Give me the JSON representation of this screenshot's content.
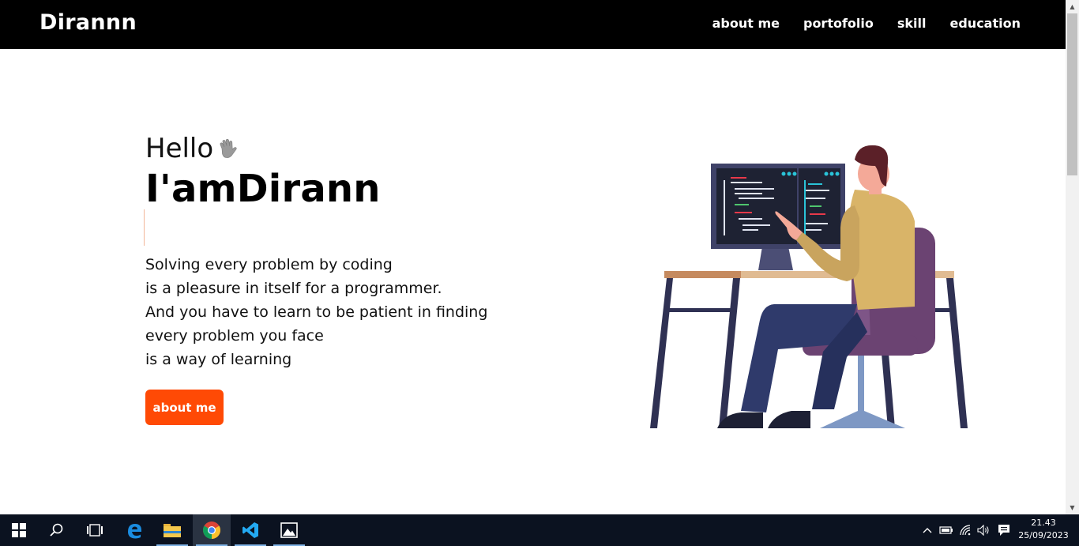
{
  "navbar": {
    "brand": "Dirannn",
    "links": [
      "about me",
      "portofolio",
      "skill",
      "education"
    ]
  },
  "hero": {
    "greeting": "Hello",
    "greeting_icon": "waving-hand-icon",
    "name": "I'amDirann",
    "description": [
      "Solving every problem by coding",
      "is a pleasure in itself for a programmer.",
      "And you have to learn to be patient in finding",
      "every problem you face",
      "is a way of learning"
    ],
    "cta_label": "about me"
  },
  "illustration": "programmer-at-desk-illustration",
  "colors": {
    "navbar_bg": "#000000",
    "accent": "#ff4a05",
    "text": "#111111"
  },
  "taskbar": {
    "apps": [
      "start-icon",
      "search-icon",
      "task-view-icon",
      "edge-icon",
      "file-explorer-icon",
      "chrome-icon",
      "vscode-icon",
      "photos-icon"
    ],
    "time": "21.43",
    "date": "25/09/2023"
  }
}
